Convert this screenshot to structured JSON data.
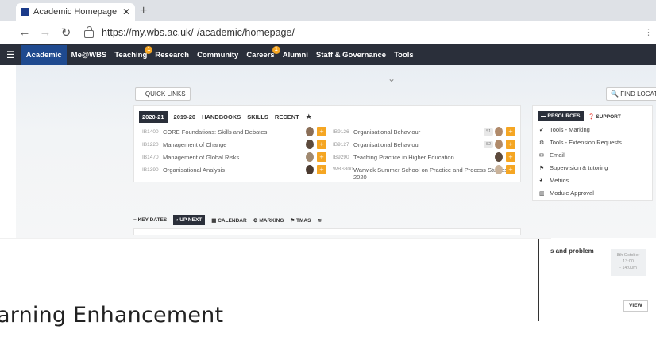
{
  "browser": {
    "tab_title": "Academic Homepage - Academi",
    "url": "https://my.wbs.ac.uk/-/academic/homepage/"
  },
  "nav": {
    "items": [
      {
        "label": "Academic",
        "active": true
      },
      {
        "label": "Me@WBS"
      },
      {
        "label": "Teaching",
        "badge": "1"
      },
      {
        "label": "Research"
      },
      {
        "label": "Community"
      },
      {
        "label": "Careers",
        "badge": "1"
      },
      {
        "label": "Alumni"
      },
      {
        "label": "Staff & Governance"
      },
      {
        "label": "Tools"
      }
    ]
  },
  "quick_links_label": "QUICK LINKS",
  "find_location_label": "FIND LOCATION...",
  "courses": {
    "tabs": [
      "2020-21",
      "2019-20",
      "HANDBOOKS",
      "SKILLS",
      "RECENT"
    ],
    "left": [
      {
        "code": "IB1400",
        "name": "CORE Foundations: Skills and Debates"
      },
      {
        "code": "IB1220",
        "name": "Management of Change"
      },
      {
        "code": "IB1470",
        "name": "Management of Global Risks"
      },
      {
        "code": "IB1390",
        "name": "Organisational Analysis"
      }
    ],
    "right": [
      {
        "code": "IB9126",
        "name": "Organisational Behaviour",
        "pill": "S1"
      },
      {
        "code": "IB9127",
        "name": "Organisational Behaviour",
        "pill": "S2"
      },
      {
        "code": "IB9290",
        "name": "Teaching Practice in Higher Education"
      },
      {
        "code": "WBS300",
        "name": "Warwick Summer School on Practice and Process Studies",
        "name2": "2020"
      }
    ]
  },
  "resources": {
    "tabs": [
      "RESOURCES",
      "SUPPORT"
    ],
    "items": [
      {
        "icon": "check-icon",
        "label": "Tools - Marking"
      },
      {
        "icon": "gear-icon",
        "label": "Tools - Extension Requests"
      },
      {
        "icon": "mail-icon",
        "label": "Email"
      },
      {
        "icon": "flag-icon",
        "label": "Supervision & tutoring"
      },
      {
        "icon": "pie-icon",
        "label": "Metrics"
      },
      {
        "icon": "bank-icon",
        "label": "Module Approval"
      }
    ]
  },
  "bottom_tabs": [
    "KEY DATES",
    "UP NEXT",
    "CALENDAR",
    "MARKING",
    "TMAS",
    "RSS"
  ],
  "event": {
    "title": "s and problem",
    "date_line1": "8th October",
    "date_line2": "13:00",
    "date_line3": "- 14:00m",
    "view_label": "VIEW"
  },
  "heading": "arning Enhancement"
}
